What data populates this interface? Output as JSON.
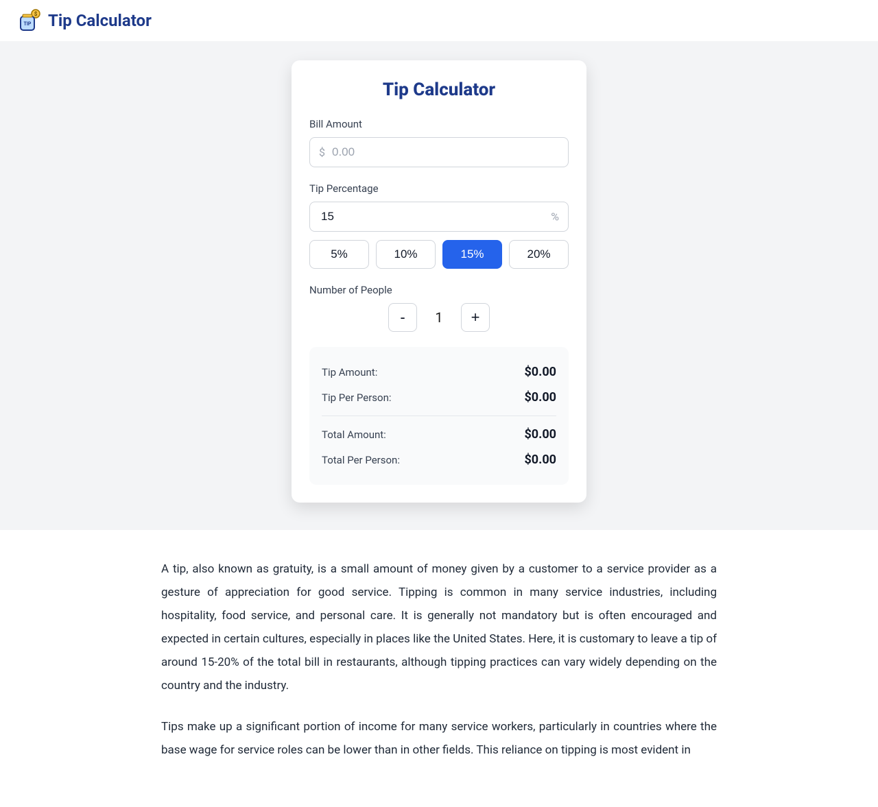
{
  "header": {
    "title": "Tip Calculator"
  },
  "card": {
    "title": "Tip Calculator",
    "bill": {
      "label": "Bill Amount",
      "prefix": "$",
      "placeholder": "0.00",
      "value": ""
    },
    "tip_percentage": {
      "label": "Tip Percentage",
      "suffix": "%",
      "value": "15",
      "presets": [
        {
          "label": "5%",
          "value": 5,
          "active": false
        },
        {
          "label": "10%",
          "value": 10,
          "active": false
        },
        {
          "label": "15%",
          "value": 15,
          "active": true
        },
        {
          "label": "20%",
          "value": 20,
          "active": false
        }
      ]
    },
    "people": {
      "label": "Number of People",
      "minus": "-",
      "plus": "+",
      "value": "1"
    },
    "results": {
      "tip_amount_label": "Tip Amount:",
      "tip_amount_value": "$0.00",
      "tip_per_person_label": "Tip Per Person:",
      "tip_per_person_value": "$0.00",
      "total_amount_label": "Total Amount:",
      "total_amount_value": "$0.00",
      "total_per_person_label": "Total Per Person:",
      "total_per_person_value": "$0.00"
    }
  },
  "article": {
    "p1": "A tip, also known as gratuity, is a small amount of money given by a customer to a service provider as a gesture of appreciation for good service. Tipping is common in many service industries, including hospitality, food service, and personal care. It is generally not mandatory but is often encouraged and expected in certain cultures, especially in places like the United States. Here, it is customary to leave a tip of around 15-20% of the total bill in restaurants, although tipping practices can vary widely depending on the country and the industry.",
    "p2": "Tips make up a significant portion of income for many service workers, particularly in countries where the base wage for service roles can be lower than in other fields. This reliance on tipping is most evident in"
  }
}
